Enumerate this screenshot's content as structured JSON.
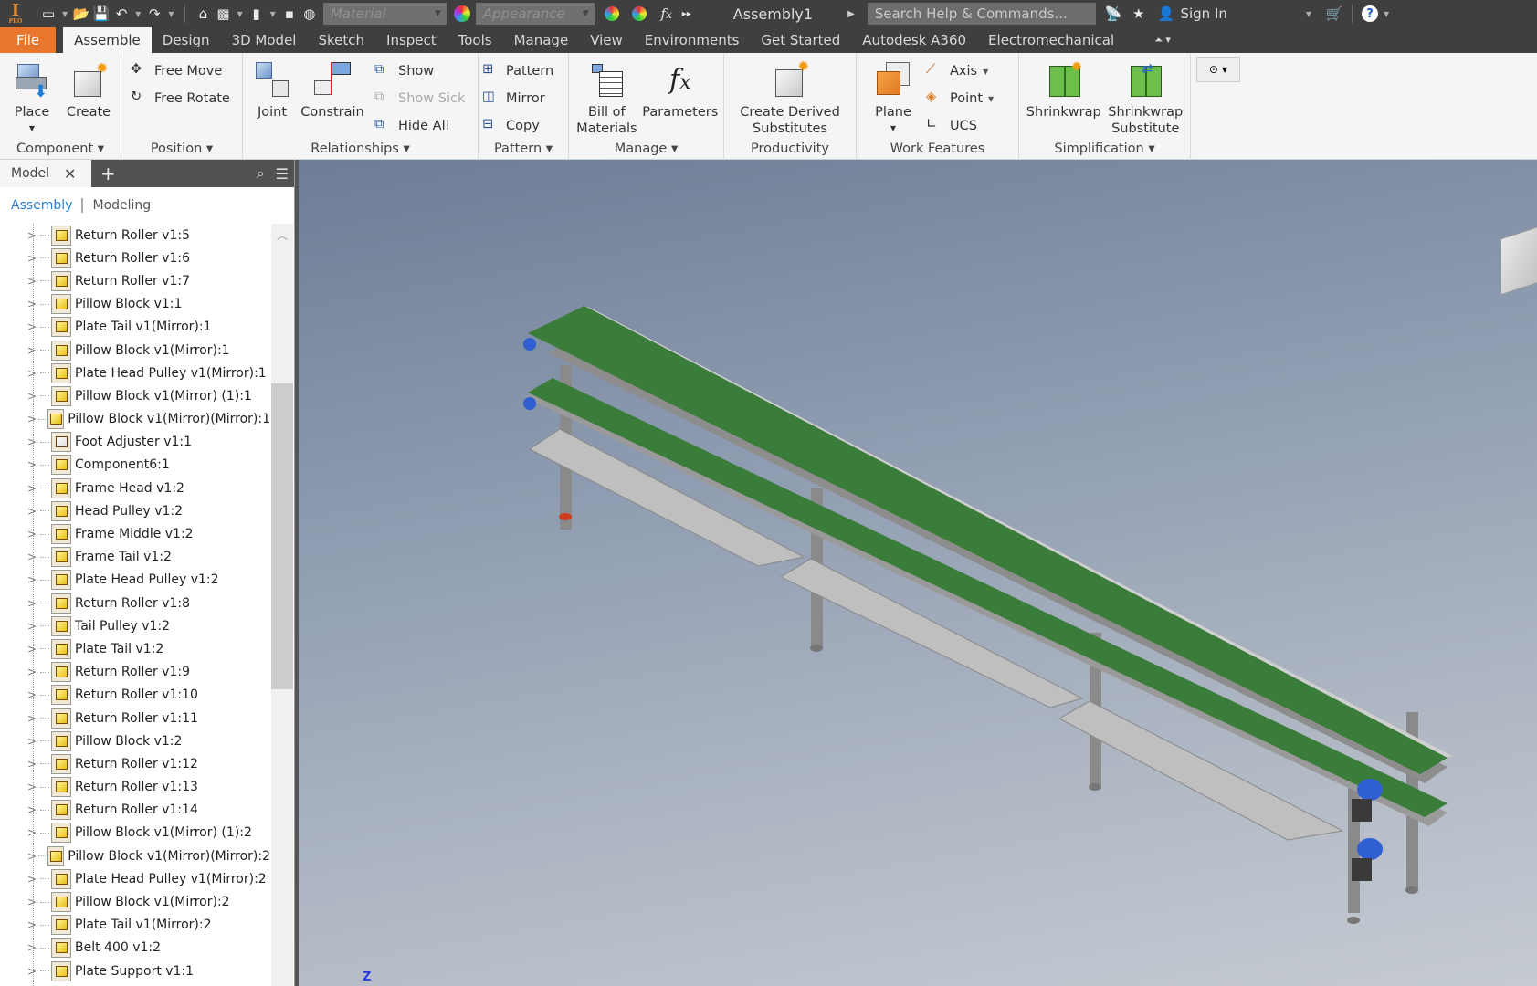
{
  "app": {
    "logo_letter": "I",
    "logo_sub": "PRO",
    "document_title": "Assembly1",
    "material_placeholder": "Material",
    "appearance_placeholder": "Appearance",
    "search_placeholder": "Search Help & Commands...",
    "sign_in": "Sign In"
  },
  "tabs": [
    {
      "label": "File"
    },
    {
      "label": "Assemble"
    },
    {
      "label": "Design"
    },
    {
      "label": "3D Model"
    },
    {
      "label": "Sketch"
    },
    {
      "label": "Inspect"
    },
    {
      "label": "Tools"
    },
    {
      "label": "Manage"
    },
    {
      "label": "View"
    },
    {
      "label": "Environments"
    },
    {
      "label": "Get Started"
    },
    {
      "label": "Autodesk A360"
    },
    {
      "label": "Electromechanical"
    }
  ],
  "ribbon": {
    "component": {
      "label": "Component",
      "place": "Place",
      "create": "Create"
    },
    "position": {
      "label": "Position",
      "free_move": "Free Move",
      "free_rotate": "Free Rotate"
    },
    "relationships": {
      "label": "Relationships",
      "joint": "Joint",
      "constrain": "Constrain",
      "show": "Show",
      "show_sick": "Show Sick",
      "hide_all": "Hide All"
    },
    "pattern": {
      "label": "Pattern",
      "pattern": "Pattern",
      "mirror": "Mirror",
      "copy": "Copy"
    },
    "manage": {
      "label": "Manage",
      "bom_line1": "Bill of",
      "bom_line2": "Materials",
      "parameters": "Parameters"
    },
    "productivity": {
      "label": "Productivity",
      "cds_line1": "Create Derived",
      "cds_line2": "Substitutes"
    },
    "work_features": {
      "label": "Work Features",
      "plane": "Plane",
      "axis": "Axis",
      "point": "Point",
      "ucs": "UCS"
    },
    "simplification": {
      "label": "Simplification",
      "shrinkwrap": "Shrinkwrap",
      "sws_line1": "Shrinkwrap",
      "sws_line2": "Substitute"
    }
  },
  "browser": {
    "tab_label": "Model",
    "mode_assembly": "Assembly",
    "mode_modeling": "Modeling",
    "items": [
      {
        "label": "Return Roller v1:5",
        "type": "part"
      },
      {
        "label": "Return Roller v1:6",
        "type": "part"
      },
      {
        "label": "Return Roller v1:7",
        "type": "part"
      },
      {
        "label": "Pillow Block v1:1",
        "type": "part"
      },
      {
        "label": "Plate Tail v1(Mirror):1",
        "type": "part"
      },
      {
        "label": "Pillow Block v1(Mirror):1",
        "type": "part"
      },
      {
        "label": "Plate Head Pulley v1(Mirror):1",
        "type": "part"
      },
      {
        "label": "Pillow Block v1(Mirror) (1):1",
        "type": "part"
      },
      {
        "label": "Pillow Block v1(Mirror)(Mirror):1",
        "type": "part"
      },
      {
        "label": "Foot Adjuster v1:1",
        "type": "assembly"
      },
      {
        "label": "Component6:1",
        "type": "part"
      },
      {
        "label": "Frame Head v1:2",
        "type": "part"
      },
      {
        "label": "Head Pulley v1:2",
        "type": "part"
      },
      {
        "label": "Frame Middle v1:2",
        "type": "part"
      },
      {
        "label": "Frame Tail v1:2",
        "type": "part"
      },
      {
        "label": "Plate Head Pulley v1:2",
        "type": "part"
      },
      {
        "label": "Return Roller v1:8",
        "type": "part"
      },
      {
        "label": "Tail Pulley v1:2",
        "type": "part"
      },
      {
        "label": "Plate Tail v1:2",
        "type": "part"
      },
      {
        "label": "Return Roller v1:9",
        "type": "part"
      },
      {
        "label": "Return Roller v1:10",
        "type": "part"
      },
      {
        "label": "Return Roller v1:11",
        "type": "part"
      },
      {
        "label": "Pillow Block v1:2",
        "type": "part"
      },
      {
        "label": "Return Roller v1:12",
        "type": "part"
      },
      {
        "label": "Return Roller v1:13",
        "type": "part"
      },
      {
        "label": "Return Roller v1:14",
        "type": "part"
      },
      {
        "label": "Pillow Block v1(Mirror) (1):2",
        "type": "part"
      },
      {
        "label": "Pillow Block v1(Mirror)(Mirror):2",
        "type": "part"
      },
      {
        "label": "Plate Head Pulley v1(Mirror):2",
        "type": "part"
      },
      {
        "label": "Pillow Block v1(Mirror):2",
        "type": "part"
      },
      {
        "label": "Plate Tail v1(Mirror):2",
        "type": "part"
      },
      {
        "label": "Belt 400 v1:2",
        "type": "part"
      },
      {
        "label": "Plate Support v1:1",
        "type": "part"
      }
    ]
  },
  "viewport": {
    "axis_label": "Z",
    "colors": {
      "belt": "#3a7d3a",
      "frame": "#9a9a9a",
      "plate": "#bfbfbf",
      "motor": "#2f5fd0",
      "foot": "#d03a20"
    }
  }
}
